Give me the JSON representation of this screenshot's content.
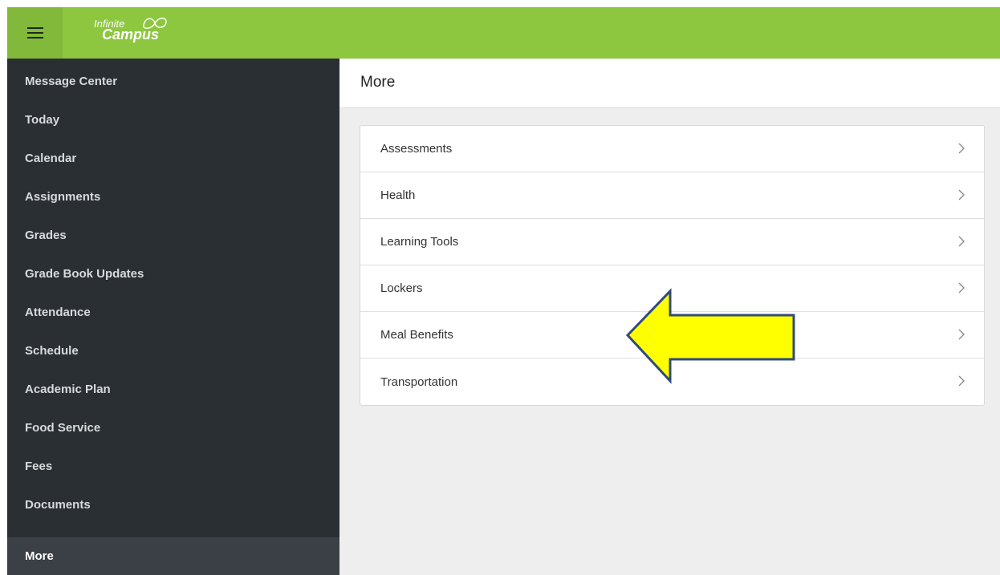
{
  "app": {
    "logo_line1": "Infinite",
    "logo_line2": "Campus",
    "brand_color": "#8dc63f"
  },
  "header": {
    "menu_icon": "hamburger-menu-icon"
  },
  "sidebar": {
    "items": [
      {
        "label": "Message Center"
      },
      {
        "label": "Today"
      },
      {
        "label": "Calendar"
      },
      {
        "label": "Assignments"
      },
      {
        "label": "Grades"
      },
      {
        "label": "Grade Book Updates"
      },
      {
        "label": "Attendance"
      },
      {
        "label": "Schedule"
      },
      {
        "label": "Academic Plan"
      },
      {
        "label": "Food Service"
      },
      {
        "label": "Fees"
      },
      {
        "label": "Documents"
      },
      {
        "label": "More",
        "active": true
      }
    ]
  },
  "main": {
    "title": "More",
    "list": [
      {
        "label": "Assessments"
      },
      {
        "label": "Health"
      },
      {
        "label": "Learning Tools"
      },
      {
        "label": "Lockers"
      },
      {
        "label": "Meal Benefits"
      },
      {
        "label": "Transportation"
      }
    ],
    "row_icon": "chevron-right-icon"
  },
  "annotation": {
    "icon": "arrow-left-icon",
    "fill": "#ffff00",
    "stroke": "#2f4b7c"
  }
}
